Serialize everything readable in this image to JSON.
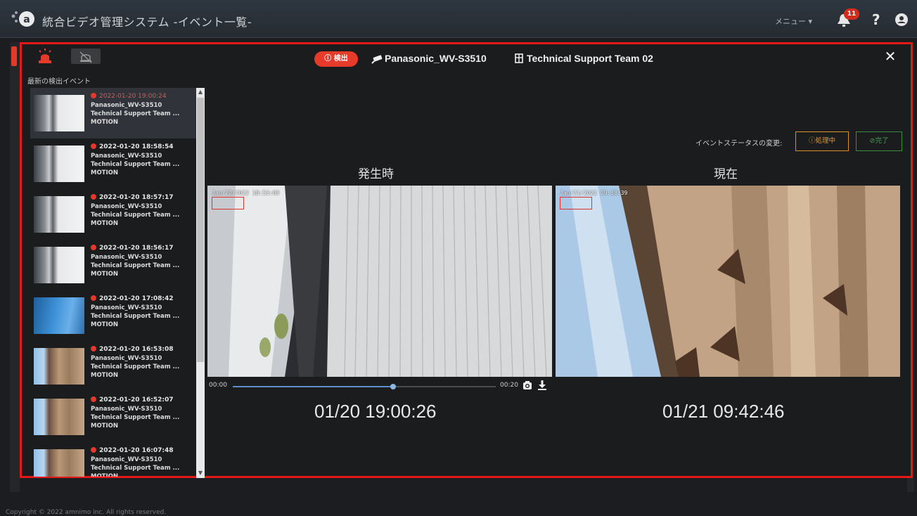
{
  "app": {
    "title": "統合ビデオ管理システム -イベント一覧-",
    "menu_label": "メニュー ▾",
    "notification_count": "11",
    "help_label": "?"
  },
  "modal": {
    "detect_badge": "検出",
    "camera_name": "Panasonic_WV-S3510",
    "team_name": "Technical Support Team 02",
    "list_title": "最新の検出イベント",
    "status_label": "イベントステータスの変更:",
    "btn_processing": "処理中",
    "btn_done": "完了",
    "label_occur": "発生時",
    "label_now": "現在",
    "osd_occur": "Jan/20/2022 18:53:03",
    "osd_now": "Jan/21/2022 09:38:39",
    "timeline_start": "00:00",
    "timeline_end": "00:20",
    "timeline_progress": 0.61,
    "time_occur": "01/20 19:00:26",
    "time_now": "01/21 09:42:46"
  },
  "events": [
    {
      "time": "2022-01-20 19:00:24",
      "camera": "Panasonic_WV-S3510",
      "team": "Technical Support Team ...",
      "type": "MOTION",
      "selected": true
    },
    {
      "time": "2022-01-20 18:58:54",
      "camera": "Panasonic_WV-S3510",
      "team": "Technical Support Team ...",
      "type": "MOTION"
    },
    {
      "time": "2022-01-20 18:57:17",
      "camera": "Panasonic_WV-S3510",
      "team": "Technical Support Team ...",
      "type": "MOTION"
    },
    {
      "time": "2022-01-20 18:56:17",
      "camera": "Panasonic_WV-S3510",
      "team": "Technical Support Team ...",
      "type": "MOTION"
    },
    {
      "time": "2022-01-20 17:08:42",
      "camera": "Panasonic_WV-S3510",
      "team": "Technical Support Team ...",
      "type": "MOTION"
    },
    {
      "time": "2022-01-20 16:53:08",
      "camera": "Panasonic_WV-S3510",
      "team": "Technical Support Team ...",
      "type": "MOTION"
    },
    {
      "time": "2022-01-20 16:52:07",
      "camera": "Panasonic_WV-S3510",
      "team": "Technical Support Team ...",
      "type": "MOTION"
    },
    {
      "time": "2022-01-20 16:07:48",
      "camera": "Panasonic_WV-S3510",
      "team": "Technical Support Team ...",
      "type": "MOTION"
    }
  ],
  "footer": {
    "copyright": "Copyright © 2022 amnimo inc. All rights reserved."
  },
  "colors": {
    "accent_red": "#e41818",
    "processing": "#e0962e",
    "done": "#4a9c52"
  }
}
